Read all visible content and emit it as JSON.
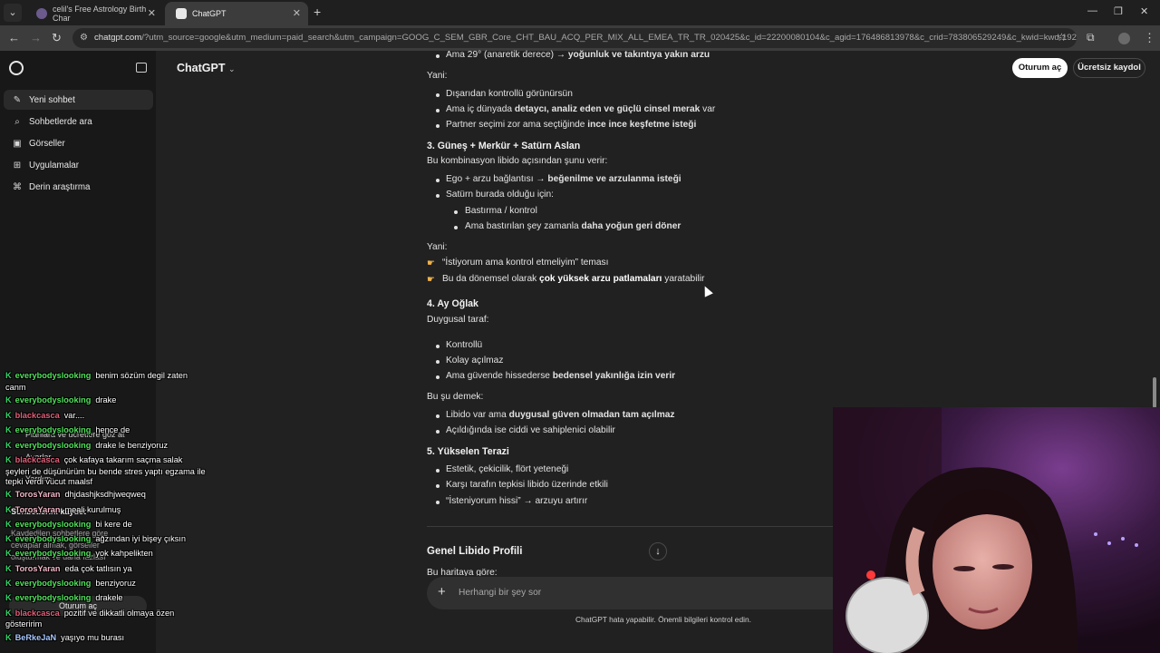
{
  "browser": {
    "tabs": [
      {
        "title": "celil's Free Astrology Birth Char",
        "active": false
      },
      {
        "title": "ChatGPT",
        "active": true
      }
    ],
    "new_tab": "+",
    "window_controls": [
      "—",
      "❐",
      "✕"
    ],
    "url_host": "chatgpt.com",
    "url_rest": "/?utm_source=google&utm_medium=paid_search&utm_campaign=GOOG_C_SEM_GBR_Core_CHT_BAU_ACQ_PER_MIX_ALL_EMEA_TR_TR_020425&c_id=22200080104&c_agid=176486813978&c_crid=783806529249&c_kwid=kwd-1927227100..."
  },
  "sidebar": {
    "items": [
      {
        "label": "Yeni sohbet",
        "icon": "edit-icon"
      },
      {
        "label": "Sohbetlerde ara",
        "icon": "search-icon"
      },
      {
        "label": "Görseller",
        "icon": "image-icon"
      },
      {
        "label": "Uygulamalar",
        "icon": "apps-icon"
      },
      {
        "label": "Derin araştırma",
        "icon": "research-icon"
      }
    ],
    "bottom": {
      "plans": "Planlara ve ücretlere göz at",
      "settings": "Ayarlar",
      "help": "Yardım",
      "save_title": "Sohbetlerini kaydet",
      "save_desc1": "Kaydedilen sohbetlere göre",
      "save_desc2": "cevaplar almak, görseller",
      "save_desc3": "oluşturmak ve daha fazlası",
      "login": "Oturum aç"
    }
  },
  "header": {
    "model": "ChatGPT",
    "login": "Oturum aç",
    "signup": "Ücretsiz kaydol"
  },
  "message": {
    "line_top_pre": "Ama 29° (anaretik derece) → ",
    "line_top_bold": "yoğunluk ve takıntıya yakın arzu",
    "yani1": "Yani:",
    "b1": "Dışarıdan kontrollü görünürsün",
    "b2_pre": "Ama iç dünyada ",
    "b2_bold": "detaycı, analiz eden ve güçlü cinsel merak",
    "b2_post": " var",
    "b3_pre": "Partner seçimi zor ama seçtiğinde ",
    "b3_bold": "ince ince keşfetme isteği",
    "h3": "3. Güneş + Merkür + Satürn Aslan",
    "p3": "Bu kombinasyon libido açısından şunu verir:",
    "b4_pre": "Ego + arzu bağlantısı → ",
    "b4_bold": "beğenilme ve arzulanma isteği",
    "b5": "Satürn burada olduğu için:",
    "b6": "Bastırma / kontrol",
    "b7_pre": "Ama bastırılan şey zamanla ",
    "b7_bold": "daha yoğun geri döner",
    "yani2": "Yani:",
    "pt1": "“İstiyorum ama kontrol etmeliyim” teması",
    "pt2_pre": "Bu da dönemsel olarak ",
    "pt2_bold": "çok yüksek arzu patlamaları",
    "pt2_post": " yaratabilir",
    "h4": "4. Ay Oğlak",
    "p4": "Duygusal taraf:",
    "b8": "Kontrollü",
    "b9": "Kolay açılmaz",
    "b10_pre": "Ama güvende hissederse ",
    "b10_bold": "bedensel yakınlığa izin verir",
    "p5": "Bu şu demek:",
    "b11_pre": "Libido var ama ",
    "b11_bold": "duygusal güven olmadan tam açılmaz",
    "b12": "Açıldığında ise ciddi ve sahiplenici olabilir",
    "h5": "5. Yükselen Terazi",
    "b13": "Estetik, çekicilik, flört yeteneği",
    "b14": "Karşı tarafın tepkisi libido üzerinde etkili",
    "b15": "“İsteniyorum hissi” → arzuyu artırır",
    "genel": "Genel Libido Profili",
    "partial": "Bu haritaya göre:"
  },
  "composer": {
    "placeholder": "Herhangi bir şey sor",
    "plus": "+"
  },
  "footnote": "ChatGPT hata yapabilir. Önemli bilgileri kontrol edin.",
  "chat_overlay": [
    {
      "user": "everybodyslooking",
      "color": "green",
      "text": "benim sözüm degil zaten",
      "cont": "canm"
    },
    {
      "user": "everybodyslooking",
      "color": "green",
      "text": "drake"
    },
    {
      "user": "blackcasca",
      "color": "red",
      "text": "var...."
    },
    {
      "user": "everybodyslooking",
      "color": "green",
      "text": "hence de"
    },
    {
      "user": "everybodyslooking",
      "color": "green",
      "text": "drake le benziyoruz"
    },
    {
      "user": "blackcasca",
      "color": "red",
      "text": "çok kafaya takarım saçma salak",
      "cont": "şeyleri de düşünürüm bu bende stres yaptı egzama ile",
      "cont2": "tepki verdi vücut maalsf"
    },
    {
      "user": "TorosYaran",
      "color": "pink",
      "text": "dhjdashjksdhjweqweq"
    },
    {
      "user": "TorosYaran",
      "color": "pink",
      "text": "meali kurulmuş"
    },
    {
      "user": "everybodyslooking",
      "color": "green",
      "text": "bi kere de"
    },
    {
      "user": "everybodyslooking",
      "color": "green",
      "text": "ağzından iyi bişey çıksın"
    },
    {
      "user": "everybodyslooking",
      "color": "green",
      "text": "yok kahpelikten"
    },
    {
      "user": "TorosYaran",
      "color": "pink",
      "text": "eda çok tatlısın ya"
    },
    {
      "user": "everybodyslooking",
      "color": "green",
      "text": "benziyoruz"
    },
    {
      "user": "everybodyslooking",
      "color": "green",
      "text": "drakele"
    },
    {
      "user": "blackcasca",
      "color": "red",
      "text": "pozitif ve dikkatli olmaya özen",
      "cont": "gösteririm"
    },
    {
      "user": "BeRkeJaN",
      "color": "blue",
      "text": "yaşıyo mu burası"
    }
  ],
  "chat_badge": "K"
}
